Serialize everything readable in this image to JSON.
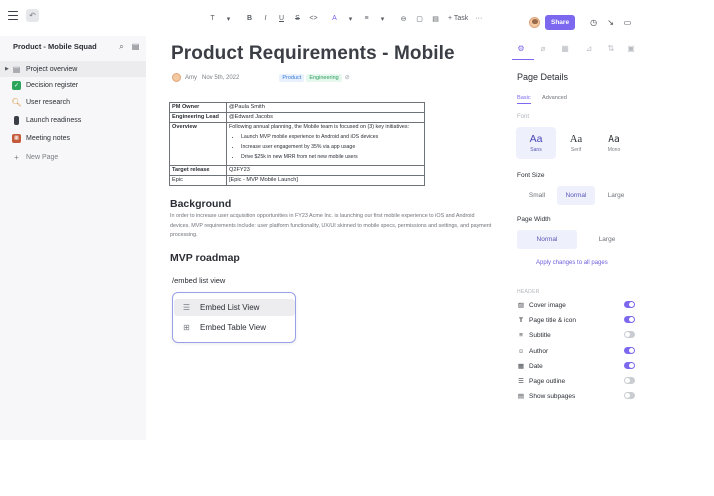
{
  "topbar": {
    "toolbar": {
      "text_style": "T",
      "bold": "B",
      "italic": "I",
      "underline": "U",
      "strike": "S",
      "code": "<>",
      "color": "A",
      "align": "≡",
      "task_label": "+ Task",
      "more": "···"
    },
    "share_label": "Share"
  },
  "sidebar": {
    "title": "Product - Mobile Squad",
    "items": [
      {
        "label": "Project overview",
        "icon": "document-icon",
        "color": "#6e7279"
      },
      {
        "label": "Decision register",
        "icon": "check-box-icon",
        "color": "#2aa55b"
      },
      {
        "label": "User research",
        "icon": "magnifier-icon",
        "color": "#d08a2a"
      },
      {
        "label": "Launch readiness",
        "icon": "traffic-light-icon",
        "color": "#3b3f45"
      },
      {
        "label": "Meeting notes",
        "icon": "calendar-icon",
        "color": "#c45a3a"
      }
    ],
    "new_page_label": "New Page"
  },
  "doc": {
    "title": "Product Requirements - Mobile",
    "author": "Amy",
    "date": "Nov 5th, 2022",
    "tags": [
      "Product",
      "Engineering"
    ],
    "table": {
      "pm_owner_key": "PM Owner",
      "pm_owner_val": "@Paula Smith",
      "eng_lead_key": "Engineering Lead",
      "eng_lead_val": "@Edward Jacobs",
      "overview_key": "Overview",
      "overview_lead": "Following annual planning, the Mobile team is focused on (3) key initiatives:",
      "overview_items": [
        "Launch MVP mobile experience to Android and iOS devices",
        "Increase user engagement by 35% via app usage",
        "Drive $25k in new MRR from net new mobile users"
      ],
      "target_key": "Target release",
      "target_val": "Q2FY23",
      "epic_key": "Epic",
      "epic_val": "[Epic - MVP Mobile Launch]"
    },
    "background_heading": "Background",
    "background_text": "In order to increase user acquisition opportunities in FY23 Acme Inc. is launching our first mobile experience to iOS and Android devices. MVP requirements include: user platform functionality, UX/UI skinned to mobile specs, permissions and settings, and payment processing.",
    "roadmap_heading": "MVP roadmap",
    "slash_command": "/embed list view",
    "slash_menu": [
      {
        "label": "Embed List View"
      },
      {
        "label": "Embed Table View"
      }
    ]
  },
  "panel": {
    "title": "Page Details",
    "subtabs": [
      "Basic",
      "Advanced"
    ],
    "font_label": "Font",
    "fonts": [
      {
        "glyph": "Aa",
        "name": "Sans"
      },
      {
        "glyph": "Aa",
        "name": "Serif"
      },
      {
        "glyph": "Aa",
        "name": "Mono"
      }
    ],
    "font_size_label": "Font Size",
    "font_sizes": [
      "Small",
      "Normal",
      "Large"
    ],
    "page_width_label": "Page Width",
    "page_widths": [
      "Normal",
      "Large"
    ],
    "apply_label": "Apply changes to all pages",
    "header_label": "HEADER",
    "toggles": [
      {
        "label": "Cover image",
        "on": true,
        "icon": "image-icon"
      },
      {
        "label": "Page title & icon",
        "on": true,
        "icon": "title-icon"
      },
      {
        "label": "Subtitle",
        "on": false,
        "icon": "subtitle-icon"
      },
      {
        "label": "Author",
        "on": true,
        "icon": "author-icon"
      },
      {
        "label": "Date",
        "on": true,
        "icon": "date-icon"
      },
      {
        "label": "Page outline",
        "on": false,
        "icon": "outline-icon"
      },
      {
        "label": "Show subpages",
        "on": false,
        "icon": "subpages-icon"
      }
    ]
  }
}
